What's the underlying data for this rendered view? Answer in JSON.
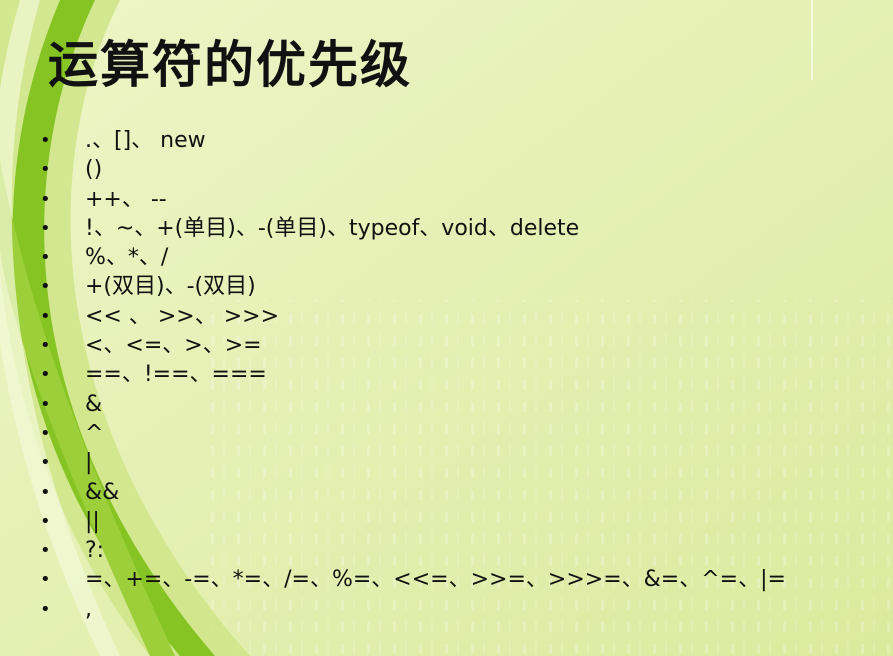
{
  "slide": {
    "title": "运算符的优先级",
    "bullet_glyph": "•",
    "bullets": [
      ".、[]、 new",
      "()",
      "++、 --",
      "!、~、+(单目)、-(单目)、typeof、void、delete",
      "%、*、/",
      "+(双目)、-(双目)",
      "<< 、 >>、 >>>",
      "<、<=、>、>=",
      "==、!==、===",
      "&",
      "^",
      "|",
      "&&",
      "||",
      "?:",
      "=、+=、-=、*=、/=、%=、<<=、>>=、>>>=、&=、^=、|=",
      ","
    ]
  },
  "colors": {
    "background": "#e6f0b8",
    "swoosh_dark": "#7fc21b",
    "swoosh_light": "#c6e07a",
    "text": "#111111"
  }
}
